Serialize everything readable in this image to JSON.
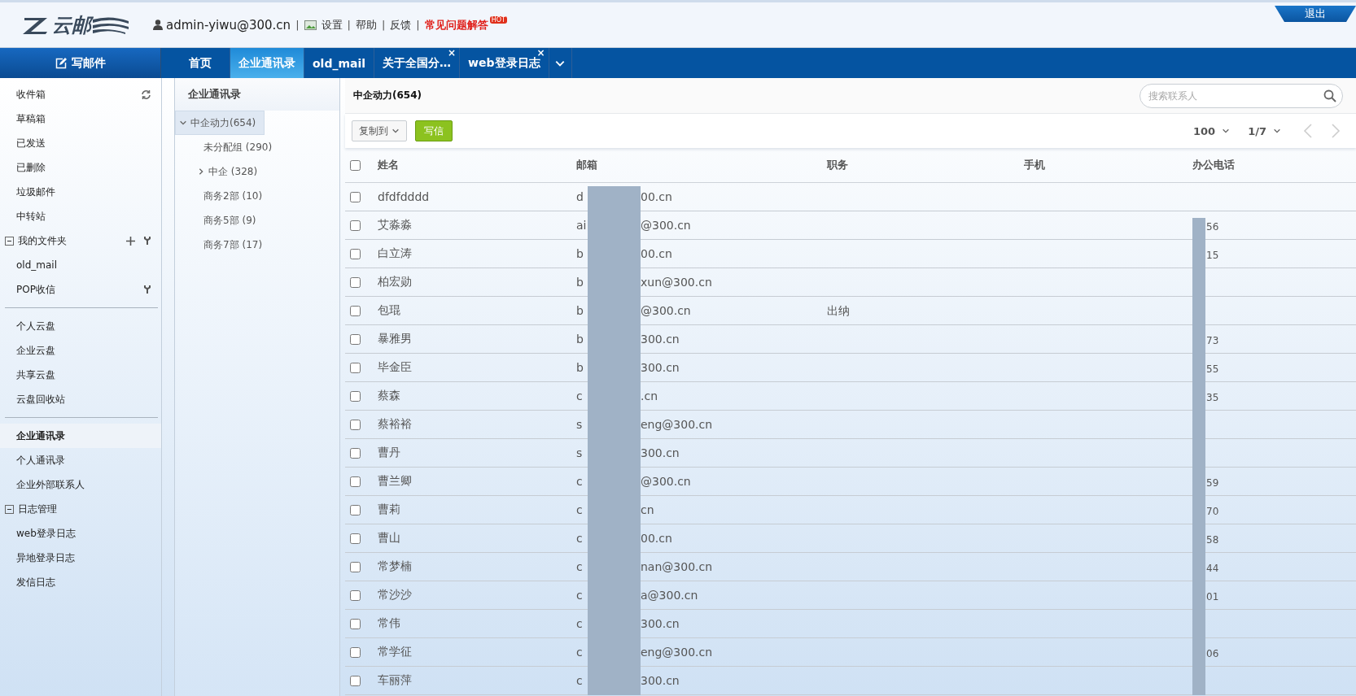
{
  "header": {
    "logo": {
      "text": "云邮"
    },
    "user": "admin-yiwu@300.cn",
    "links": [
      {
        "label": "设置",
        "hot": false
      },
      {
        "label": "帮助",
        "hot": false
      },
      {
        "label": "反馈",
        "hot": false
      },
      {
        "label": "常见问题解答",
        "hot": true,
        "badge": "HOT"
      }
    ],
    "logout": "退出",
    "separator": "|"
  },
  "compose": "写邮件",
  "tabs": [
    {
      "label": "首页",
      "selected": false
    },
    {
      "label": "企业通讯录",
      "selected": true
    },
    {
      "label": "old_mail",
      "selected": false
    },
    {
      "label": "关于全国分…",
      "selected": false,
      "close": "×"
    },
    {
      "label": "web登录日志",
      "selected": false,
      "close": "×"
    }
  ],
  "sidebar": {
    "sections": [
      [
        {
          "label": "收件箱",
          "kind": "inbox",
          "selected": false
        },
        {
          "label": "草稿箱",
          "kind": "item",
          "selected": false
        },
        {
          "label": "已发送",
          "kind": "item",
          "selected": false
        },
        {
          "label": "已删除",
          "kind": "item",
          "selected": false
        },
        {
          "label": "垃圾邮件",
          "kind": "item",
          "selected": false
        },
        {
          "label": "中转站",
          "kind": "item",
          "selected": false
        },
        {
          "label": "我的文件夹",
          "kind": "folder-group",
          "expanded": true,
          "selected": false
        },
        {
          "label": "old_mail",
          "kind": "item",
          "selected": false
        },
        {
          "label": "POP收信",
          "kind": "pop",
          "selected": false
        }
      ],
      [
        {
          "label": "个人云盘",
          "kind": "item",
          "selected": false
        },
        {
          "label": "企业云盘",
          "kind": "item",
          "selected": false
        },
        {
          "label": "共享云盘",
          "kind": "item",
          "selected": false
        },
        {
          "label": "云盘回收站",
          "kind": "item",
          "selected": false
        }
      ],
      [
        {
          "label": "企业通讯录",
          "kind": "item",
          "selected": true
        },
        {
          "label": "个人通讯录",
          "kind": "item",
          "selected": false
        },
        {
          "label": "企业外部联系人",
          "kind": "item",
          "selected": false
        },
        {
          "label": "日志管理",
          "kind": "group",
          "expanded": true,
          "selected": false
        },
        {
          "label": "web登录日志",
          "kind": "item",
          "selected": false
        },
        {
          "label": "异地登录日志",
          "kind": "item",
          "selected": false
        },
        {
          "label": "发信日志",
          "kind": "item",
          "selected": false
        }
      ]
    ]
  },
  "tree": {
    "title": "企业通讯录",
    "nodes": [
      {
        "label": "中企动力(654)",
        "expanded": true,
        "selected": true,
        "children": [
          {
            "label": "未分配组 (290)",
            "selected": false
          },
          {
            "label": "中企 (328)",
            "expanded": false,
            "selected": false
          },
          {
            "label": "商务2部 (10)",
            "selected": false
          },
          {
            "label": "商务5部 (9)",
            "selected": false
          },
          {
            "label": "商务7部 (17)",
            "selected": false
          }
        ]
      }
    ]
  },
  "contacts": {
    "title": "中企动力(654)",
    "search": {
      "placeholder": "搜索联系人"
    },
    "copy_to": "复制到",
    "write": "写信",
    "page_size": "100",
    "page": "1/7",
    "all_checked": false,
    "columns": [
      {
        "label": "姓名",
        "redacted": false
      },
      {
        "label": "邮箱",
        "redacted": true
      },
      {
        "label": "职务",
        "redacted": false
      },
      {
        "label": "手机",
        "redacted": false
      },
      {
        "label": "办公电话",
        "redacted": true
      }
    ],
    "rows": [
      {
        "name": "dfdfdddd",
        "email": {
          "head": "d",
          "tail": "00.cn"
        },
        "checked": false
      },
      {
        "name": "艾淼淼",
        "email": {
          "head": "ai",
          "tail": "@300.cn"
        },
        "office": "56",
        "checked": false
      },
      {
        "name": "白立涛",
        "email": {
          "head": "b",
          "tail": "00.cn"
        },
        "office": "15",
        "checked": false
      },
      {
        "name": "柏宏勋",
        "email": {
          "head": "b",
          "tail": "xun@300.cn"
        },
        "checked": false
      },
      {
        "name": "包琨",
        "email": {
          "head": "b",
          "tail": "@300.cn"
        },
        "title": "出纳",
        "checked": false
      },
      {
        "name": "暴雅男",
        "email": {
          "head": "b",
          "tail": "300.cn"
        },
        "office": "73",
        "checked": false
      },
      {
        "name": "毕金臣",
        "email": {
          "head": "b",
          "tail": "300.cn"
        },
        "office": "55",
        "checked": false
      },
      {
        "name": "蔡森",
        "email": {
          "head": "c",
          "tail": ".cn"
        },
        "office": "35",
        "checked": false
      },
      {
        "name": "蔡裕裕",
        "email": {
          "head": "s",
          "tail": "eng@300.cn"
        },
        "checked": false
      },
      {
        "name": "曹丹",
        "email": {
          "head": "s",
          "tail": "300.cn"
        },
        "checked": false
      },
      {
        "name": "曹兰卿",
        "email": {
          "head": "c",
          "tail": "@300.cn"
        },
        "office": "59",
        "checked": false
      },
      {
        "name": "曹莉",
        "email": {
          "head": "c",
          "tail": "cn"
        },
        "office": "70",
        "checked": false
      },
      {
        "name": "曹山",
        "email": {
          "head": "c",
          "tail": "00.cn"
        },
        "office": "58",
        "checked": false
      },
      {
        "name": "常梦楠",
        "email": {
          "head": "c",
          "tail": "nan@300.cn"
        },
        "office": "44",
        "checked": false
      },
      {
        "name": "常沙沙",
        "email": {
          "head": "c",
          "tail": "a@300.cn"
        },
        "office": "01",
        "checked": false
      },
      {
        "name": "常伟",
        "email": {
          "head": "c",
          "tail": "300.cn"
        },
        "checked": false
      },
      {
        "name": "常学征",
        "email": {
          "head": "c",
          "tail": "eng@300.cn"
        },
        "office": "06",
        "checked": false
      },
      {
        "name": "车丽萍",
        "email": {
          "head": "c",
          "tail": "300.cn"
        },
        "checked": false
      }
    ]
  }
}
